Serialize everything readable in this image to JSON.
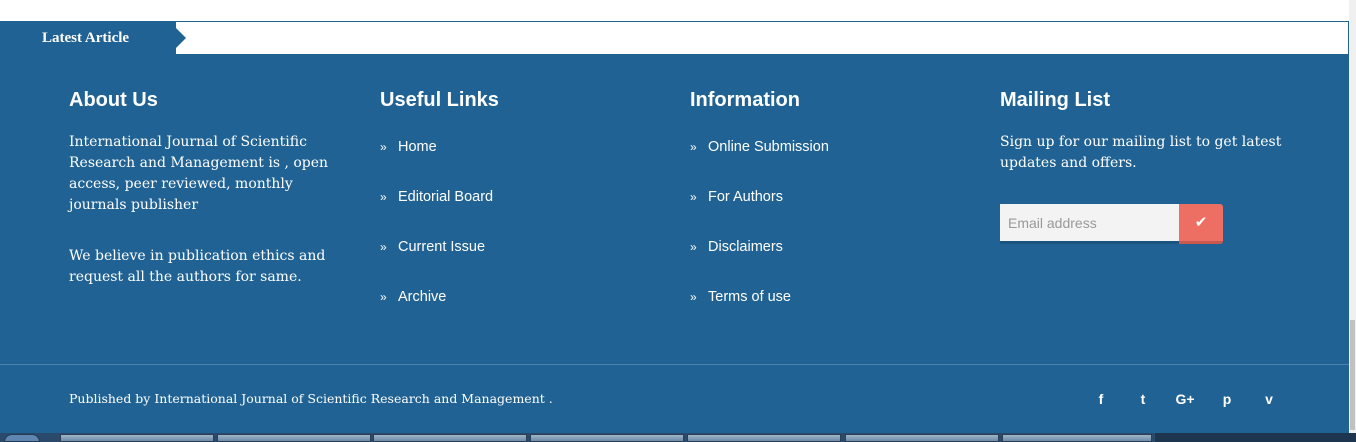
{
  "ticker": {
    "label": "Latest Article"
  },
  "about": {
    "title": "About Us",
    "paragraphs": [
      "International Journal of Scientific Research and Management is , open access, peer reviewed, monthly journals publisher",
      "We believe in publication ethics and request all the authors for same."
    ]
  },
  "useful_links": {
    "title": "Useful Links",
    "items": [
      {
        "label": "Home"
      },
      {
        "label": "Editorial Board"
      },
      {
        "label": "Current Issue"
      },
      {
        "label": "Archive"
      }
    ]
  },
  "information": {
    "title": "Information",
    "items": [
      {
        "label": "Online Submission"
      },
      {
        "label": "For Authors"
      },
      {
        "label": "Disclaimers"
      },
      {
        "label": "Terms of use"
      }
    ]
  },
  "mailing": {
    "title": "Mailing List",
    "text": "Sign up for our mailing list to get latest updates and offers.",
    "placeholder": "Email address",
    "submit_icon": "check-icon"
  },
  "footer": {
    "copyright": "Published by International Journal of Scientific Research and Management ."
  },
  "social": [
    {
      "name": "facebook-icon",
      "glyph": "f"
    },
    {
      "name": "twitter-icon",
      "glyph": "t"
    },
    {
      "name": "google-plus-icon",
      "glyph": "G+"
    },
    {
      "name": "pinterest-icon",
      "glyph": "p"
    },
    {
      "name": "vimeo-icon",
      "glyph": "v"
    }
  ],
  "colors": {
    "footer_bg": "#206293",
    "accent_button": "#ed6f63",
    "text": "#ffffff"
  }
}
